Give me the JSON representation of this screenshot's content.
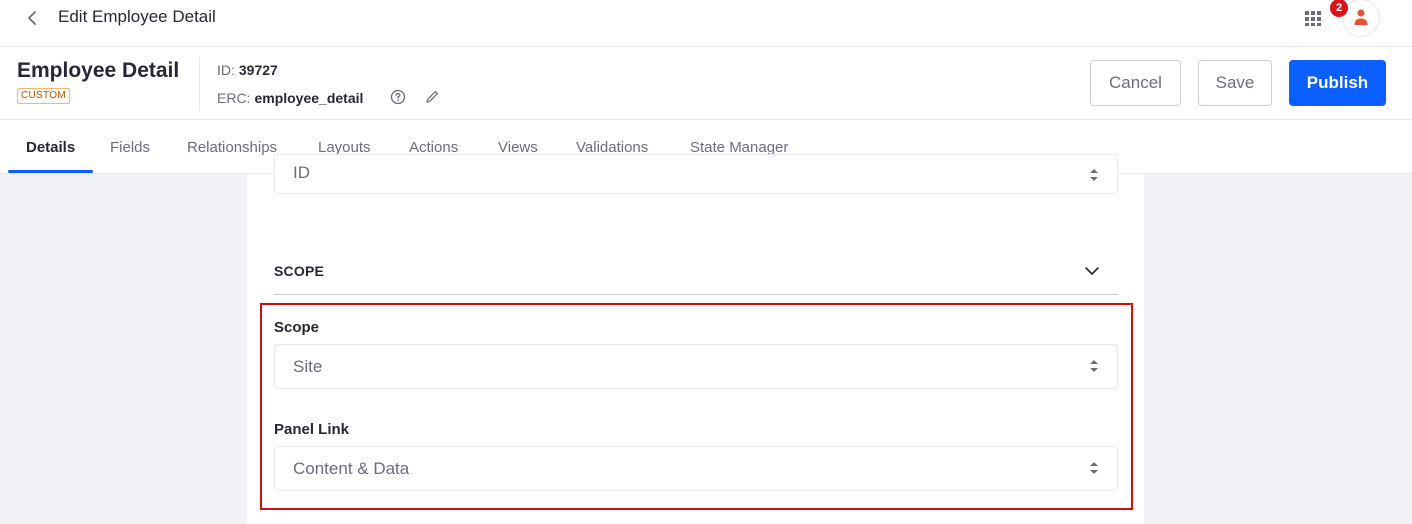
{
  "topbar": {
    "title": "Edit Employee Detail",
    "notification_count": "2"
  },
  "header": {
    "object_name": "Employee Detail",
    "badge": "CUSTOM",
    "id_label": "ID:",
    "id_value": "39727",
    "erc_label": "ERC:",
    "erc_value": "employee_detail"
  },
  "actions": {
    "cancel_label": "Cancel",
    "save_label": "Save",
    "publish_label": "Publish"
  },
  "tabs": [
    {
      "label": "Details",
      "active": true
    },
    {
      "label": "Fields"
    },
    {
      "label": "Relationships"
    },
    {
      "label": "Layouts"
    },
    {
      "label": "Actions"
    },
    {
      "label": "Views"
    },
    {
      "label": "Validations"
    },
    {
      "label": "State Manager"
    }
  ],
  "content": {
    "top_select_value": "ID",
    "section_title": "SCOPE",
    "scope": {
      "label": "Scope",
      "value": "Site"
    },
    "panel_link": {
      "label": "Panel Link",
      "value": "Content & Data"
    }
  },
  "colors": {
    "primary": "#0b5fff",
    "highlight_border": "#d10f0f",
    "badge_orange": "#b95000",
    "notification_red": "#da1414"
  }
}
